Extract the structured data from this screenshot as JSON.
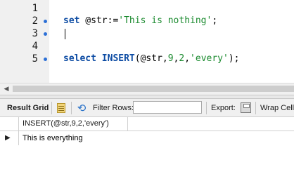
{
  "editor": {
    "lines": [
      {
        "number": "1",
        "marker": false,
        "tokens": []
      },
      {
        "number": "2",
        "marker": true,
        "tokens": [
          {
            "text": "set",
            "type": "kw"
          },
          {
            "text": " @str:=",
            "type": "plain"
          },
          {
            "text": "'This is nothing'",
            "type": "str"
          },
          {
            "text": ";",
            "type": "plain"
          }
        ]
      },
      {
        "number": "3",
        "marker": true,
        "tokens": []
      },
      {
        "number": "4",
        "marker": false,
        "tokens": []
      },
      {
        "number": "5",
        "marker": true,
        "tokens": [
          {
            "text": "select",
            "type": "kw"
          },
          {
            "text": " ",
            "type": "plain"
          },
          {
            "text": "INSERT",
            "type": "kw"
          },
          {
            "text": "(@str,",
            "type": "plain"
          },
          {
            "text": "9",
            "type": "num"
          },
          {
            "text": ",",
            "type": "plain"
          },
          {
            "text": "2",
            "type": "num"
          },
          {
            "text": ",",
            "type": "plain"
          },
          {
            "text": "'every'",
            "type": "str"
          },
          {
            "text": ");",
            "type": "plain"
          }
        ]
      }
    ],
    "colors": {
      "keyword": "#0c4ba3",
      "string": "#1a8a2e",
      "marker": "#2b6fd6"
    }
  },
  "toolbar": {
    "result_grid_label": "Result Grid",
    "filter_rows_label": "Filter Rows:",
    "filter_value": "",
    "export_label": "Export:",
    "wrap_label": "Wrap Cell C",
    "icons": [
      "grid-icon",
      "refresh-icon",
      "export-icon"
    ]
  },
  "results": {
    "columns": [
      "INSERT(@str,9,2,'every')"
    ],
    "rows": [
      [
        "This is everything"
      ]
    ]
  }
}
